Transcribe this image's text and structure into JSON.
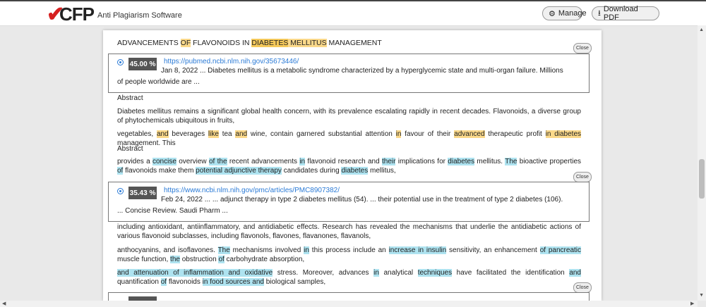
{
  "header": {
    "logo_text": "CFP",
    "subtitle": "Anti Plagiarism Software",
    "manage_label": "Manage",
    "download_label": "Download PDF"
  },
  "doc_title": {
    "pre": "ADVANCEMENTS ",
    "of": "OF",
    "mid": " FLAVONOIDS IN ",
    "diabetes": "DIABETES",
    "space": " ",
    "mellitus": "MELLITUS",
    "post": " MANAGEMENT"
  },
  "close_label": "Close",
  "sources": [
    {
      "percent": "45.00 %",
      "url": "https://pubmed.ncbi.nlm.nih.gov/35673446/",
      "snippet": "Jan 8, 2022 ... Diabetes mellitus is a metabolic syndrome characterized by a hyperglycemic state and multi-organ failure. Millions of people worldwide are ..."
    },
    {
      "percent": "35.43 %",
      "url": "https://www.ncbi.nlm.nih.gov/pmc/articles/PMC8907382/",
      "snippet": "Feb 24, 2022 ... ... adjunct therapy in type 2 diabetes mellitus (54). ... their potential use in the treatment of type 2 diabetes (106). ... Concise Review. Saudi Pharm ..."
    }
  ],
  "paragraphs": {
    "abstract1": "Abstract",
    "p1": "Diabetes mellitus remains a significant global health concern, with its prevalence escalating rapidly in recent decades. Flavonoids, a diverse group of phytochemicals ubiquitous in fruits,",
    "p2": {
      "a": "vegetables, ",
      "b": "and",
      "c": " beverages ",
      "d": "like",
      "e": " tea ",
      "f": "and",
      "g": " wine, contain garnered substantial attention ",
      "h": "in",
      "i": " favour of their ",
      "j": "advanced",
      "k": " therapeutic profit ",
      "l": "in diabetes",
      "m": " management. This"
    },
    "abstract2": "Abstract",
    "p3": {
      "a": "provides a ",
      "b": "concise",
      "c": " overview ",
      "d": "of the",
      "e": " recent advancements ",
      "f": "in",
      "g": " flavonoid research and ",
      "h": "their",
      "i": " implications for ",
      "j": "diabetes",
      "k": " mellitus. ",
      "l": "The",
      "m": " bioactive properties ",
      "n": "of",
      "o": " flavonoids make them ",
      "p": "potential adjunctive therapy",
      "q": " candidates during ",
      "r": "diabetes",
      "s": " mellitus,"
    },
    "p4": "including antioxidant, antiinflammatory, and antidiabetic effects. Research has revealed the mechanisms that underlie the antidiabetic actions of various flavonoid subclasses, including flavonols, flavones, flavanones, flavanols,",
    "p5": {
      "a": "anthocyanins, and isoflavones. ",
      "b": "The",
      "c": " mechanisms involved ",
      "d": "in",
      "e": " this process include an ",
      "f": "increase in insulin",
      "g": " sensitivity, an enhancement ",
      "h": "of pancreatic",
      "i": " muscle function, ",
      "j": "the",
      "k": " obstruction ",
      "l": "of",
      "m": " carbohydrate absorption,"
    },
    "p6": {
      "a": "and attenuation of inflammation and oxidative",
      "b": " stress. Moreover, advances ",
      "c": "in",
      "d": " analytical ",
      "e": "techniques",
      "f": " have facilitated the identification ",
      "g": "and",
      "h": " quantification ",
      "i": "of",
      "j": " flavonoids ",
      "k": "in food sources and",
      "l": " biological samples,"
    }
  }
}
